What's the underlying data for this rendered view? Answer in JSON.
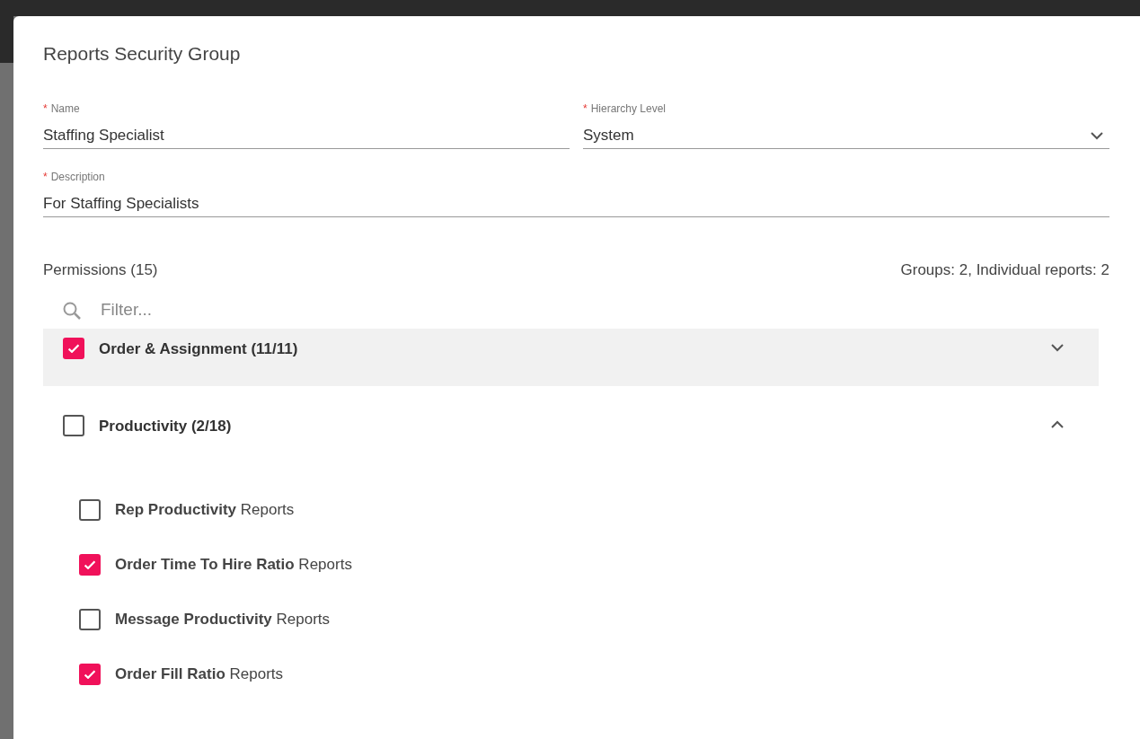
{
  "dialog": {
    "title": "Reports Security Group"
  },
  "field_rows": [
    [
      {
        "kind": "text",
        "label": "Name",
        "marker": "*",
        "value": "Staffing Specialist"
      },
      {
        "kind": "select",
        "label": "Hierarchy Level",
        "marker": "*",
        "value": "System"
      }
    ],
    [
      {
        "kind": "text",
        "label": "Description",
        "marker": "*",
        "value": "For Staffing Specialists"
      }
    ]
  ],
  "permissions": {
    "label": "Permissions (15)",
    "summary": "Groups: 2, Individual reports: 2",
    "filter": {
      "placeholder": "Filter..."
    },
    "groups": [
      {
        "label": "Order & Assignment (11/11)",
        "checked": true,
        "expanded": false,
        "selected": true
      },
      {
        "label": "Productivity (2/18)",
        "checked": false,
        "expanded": true,
        "selected": false,
        "children": [
          {
            "label": "**Rep Productivity** Reports",
            "checked": false
          },
          {
            "label": "**Order Time To Hire Ratio** Reports",
            "checked": true
          },
          {
            "label": "**Message Productivity** Reports",
            "checked": false
          },
          {
            "label": "**Order Fill Ratio** Reports",
            "checked": true
          }
        ]
      }
    ]
  }
}
